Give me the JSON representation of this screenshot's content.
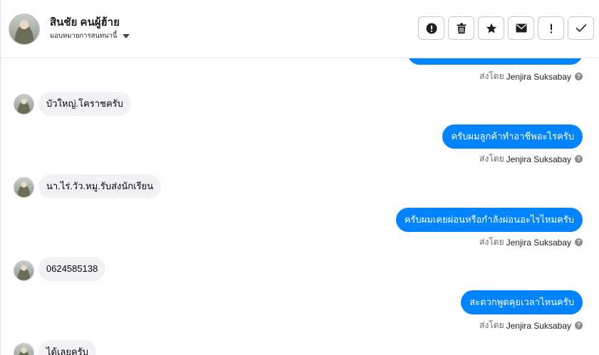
{
  "header": {
    "contact_name": "สินชัย คนผู้ฮ้าย",
    "assign_label": "มอบหมายการสนทนานี้"
  },
  "actions": [
    {
      "name": "report-spam-button",
      "icon": "exclamation-circle-icon"
    },
    {
      "name": "delete-button",
      "icon": "trash-icon"
    },
    {
      "name": "star-button",
      "icon": "star-icon"
    },
    {
      "name": "mark-unread-button",
      "icon": "envelope-icon"
    },
    {
      "name": "follow-up-button",
      "icon": "exclamation-icon"
    },
    {
      "name": "mark-done-button",
      "icon": "checkmark-icon"
    }
  ],
  "messages": {
    "m0": {
      "sent_by_prefix": "ส่งโดย",
      "sender": "Jenjira Suksabay"
    },
    "m1": {
      "text": "บัวใหญ่.โคราชครับ"
    },
    "m2": {
      "text": "ครับผมลูกค้าทำอาชีพอะไรครับ",
      "sent_by_prefix": "ส่งโดย",
      "sender": "Jenjira Suksabay"
    },
    "m3": {
      "text": "นา.ไร่.วัว.หมู.รับส่งนักเรียน"
    },
    "m4": {
      "text": "ครับผมเคยผ่อนหรือกำลังผ่อนอะไรไหมครับ",
      "sent_by_prefix": "ส่งโดย",
      "sender": "Jenjira Suksabay"
    },
    "m5": {
      "text": "0624585138"
    },
    "m6": {
      "text": "สะดวกพูดคุยเวลาไหนครับ",
      "sent_by_prefix": "ส่งโดย",
      "sender": "Jenjira Suksabay"
    },
    "m7": {
      "text": "ได้เลยครับ"
    }
  },
  "help_mark": "?"
}
